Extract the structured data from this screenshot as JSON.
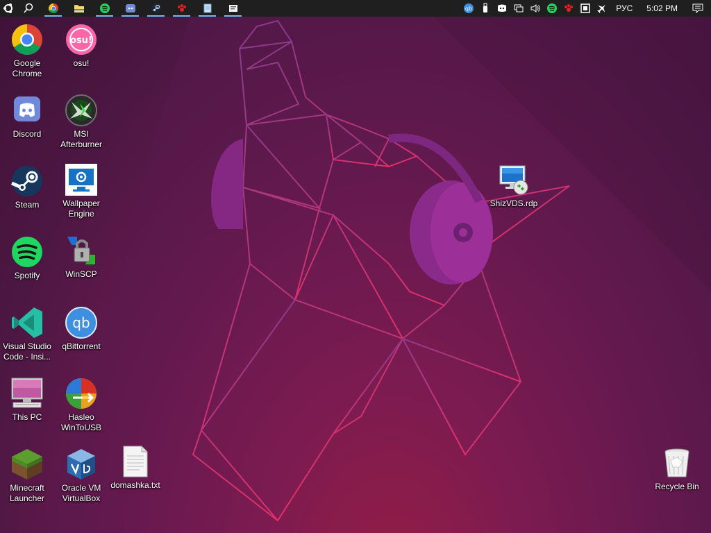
{
  "taskbar": {
    "pinned": [
      {
        "id": "start",
        "icon": "ubuntu-start-icon"
      },
      {
        "id": "search",
        "icon": "search-icon"
      },
      {
        "id": "chrome",
        "icon": "chrome-icon"
      },
      {
        "id": "explorer",
        "icon": "folder-icon"
      },
      {
        "id": "spotify",
        "icon": "spotify-icon"
      },
      {
        "id": "discord",
        "icon": "discord-icon"
      },
      {
        "id": "steam",
        "icon": "steam-icon"
      },
      {
        "id": "paws",
        "icon": "paw-icon"
      },
      {
        "id": "notepad",
        "icon": "notepad-icon"
      },
      {
        "id": "document",
        "icon": "document-icon"
      }
    ],
    "language": "РУС",
    "time": "5:02 PM"
  },
  "desktop": {
    "icons": [
      {
        "id": "chrome",
        "label_lines": [
          "Google",
          "Chrome"
        ]
      },
      {
        "id": "osu",
        "label_lines": [
          "osu!"
        ]
      },
      {
        "id": "discord",
        "label_lines": [
          "Discord"
        ]
      },
      {
        "id": "msi",
        "label_lines": [
          "MSI",
          "Afterburner"
        ]
      },
      {
        "id": "steam",
        "label_lines": [
          "Steam"
        ]
      },
      {
        "id": "wallpaper",
        "label_lines": [
          "Wallpaper",
          "Engine"
        ]
      },
      {
        "id": "spotify",
        "label_lines": [
          "Spotify"
        ]
      },
      {
        "id": "winscp",
        "label_lines": [
          "WinSCP"
        ]
      },
      {
        "id": "vscode",
        "label_lines": [
          "Visual Studio",
          "Code - Insi..."
        ]
      },
      {
        "id": "qbittorrent",
        "label_lines": [
          "qBittorrent"
        ]
      },
      {
        "id": "thispc",
        "label_lines": [
          "This PC"
        ]
      },
      {
        "id": "hasleo",
        "label_lines": [
          "Hasleo",
          "WinToUSB"
        ]
      },
      {
        "id": "minecraft",
        "label_lines": [
          "Minecraft",
          "Launcher"
        ]
      },
      {
        "id": "virtualbox",
        "label_lines": [
          "Oracle VM",
          "VirtualBox"
        ]
      },
      {
        "id": "domashka",
        "label_lines": [
          "domashka.txt"
        ]
      },
      {
        "id": "rdp",
        "label_lines": [
          "ShizVDS.rdp"
        ]
      },
      {
        "id": "recycle",
        "label_lines": [
          "Recycle Bin"
        ]
      }
    ],
    "qb_badge": "qb",
    "osu_badge": "osu!"
  },
  "colors": {
    "taskbar": "#1f1f1f",
    "running_indicator": "#76b9ed",
    "wallpaper_line": "#c2308c",
    "wallpaper_fill": "#8a2a8a"
  }
}
